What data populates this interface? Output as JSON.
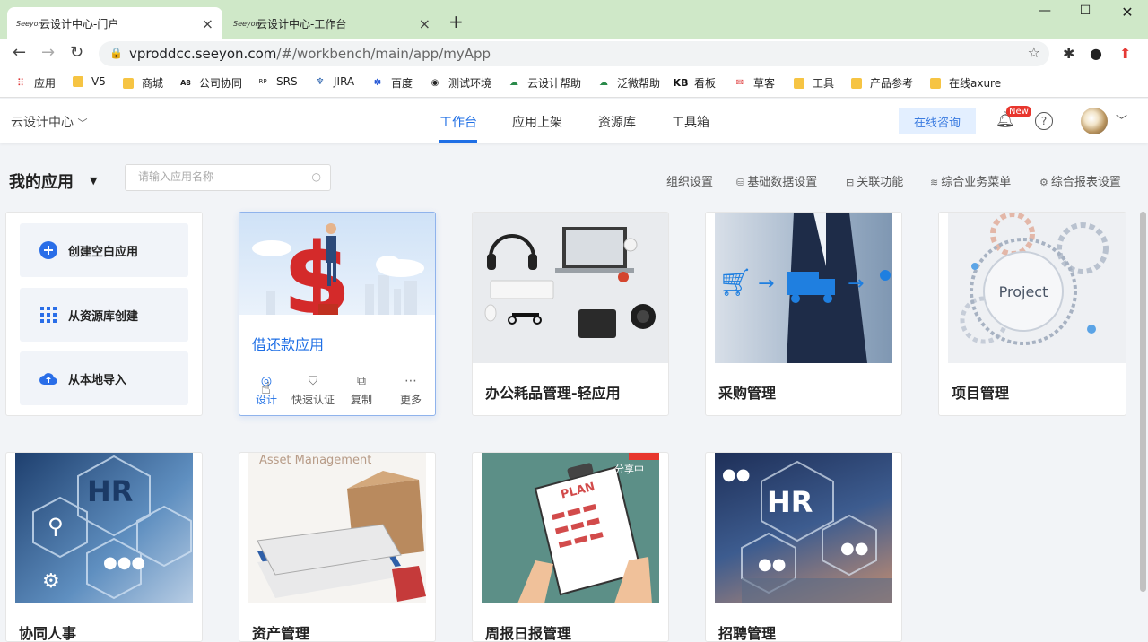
{
  "browser": {
    "tabs": [
      {
        "label": "云设计中心-门户",
        "active": true
      },
      {
        "label": "云设计中心-工作台",
        "active": false
      }
    ],
    "url_main": "vproddcc.seeyon.com",
    "url_rest": "/#/workbench/main/app/myApp",
    "bookmarks": [
      "应用",
      "V5",
      "商城",
      "公司协同",
      "SRS",
      "JIRA",
      "百度",
      "测试环境",
      "云设计帮助",
      "泛微帮助",
      "看板",
      "草客",
      "工具",
      "产品参考",
      "在线axure"
    ]
  },
  "header": {
    "brand": "云设计中心",
    "nav": [
      "工作台",
      "应用上架",
      "资源库",
      "工具箱"
    ],
    "consult": "在线咨询",
    "badge": "New",
    "help": "?"
  },
  "toolbar": {
    "title": "我的应用",
    "search_placeholder": "请输入应用名称",
    "links": [
      "组织设置",
      "基础数据设置",
      "关联功能",
      "综合业务菜单",
      "综合报表设置"
    ]
  },
  "create": {
    "buttons": [
      "创建空白应用",
      "从资源库创建",
      "从本地导入"
    ]
  },
  "apps": [
    {
      "title": "借还款应用"
    },
    {
      "title": "办公耗品管理-轻应用"
    },
    {
      "title": "采购管理"
    },
    {
      "title": "项目管理"
    },
    {
      "title": "协同人事"
    },
    {
      "title": "资产管理"
    },
    {
      "title": "周报日报管理"
    },
    {
      "title": "招聘管理"
    }
  ],
  "quick_actions": [
    "设计",
    "快速认证",
    "复制",
    "更多"
  ],
  "image_text": {
    "project": "Project",
    "hr": "HR",
    "asset": "Asset Management",
    "plan": "PLAN",
    "share": "分享中"
  }
}
